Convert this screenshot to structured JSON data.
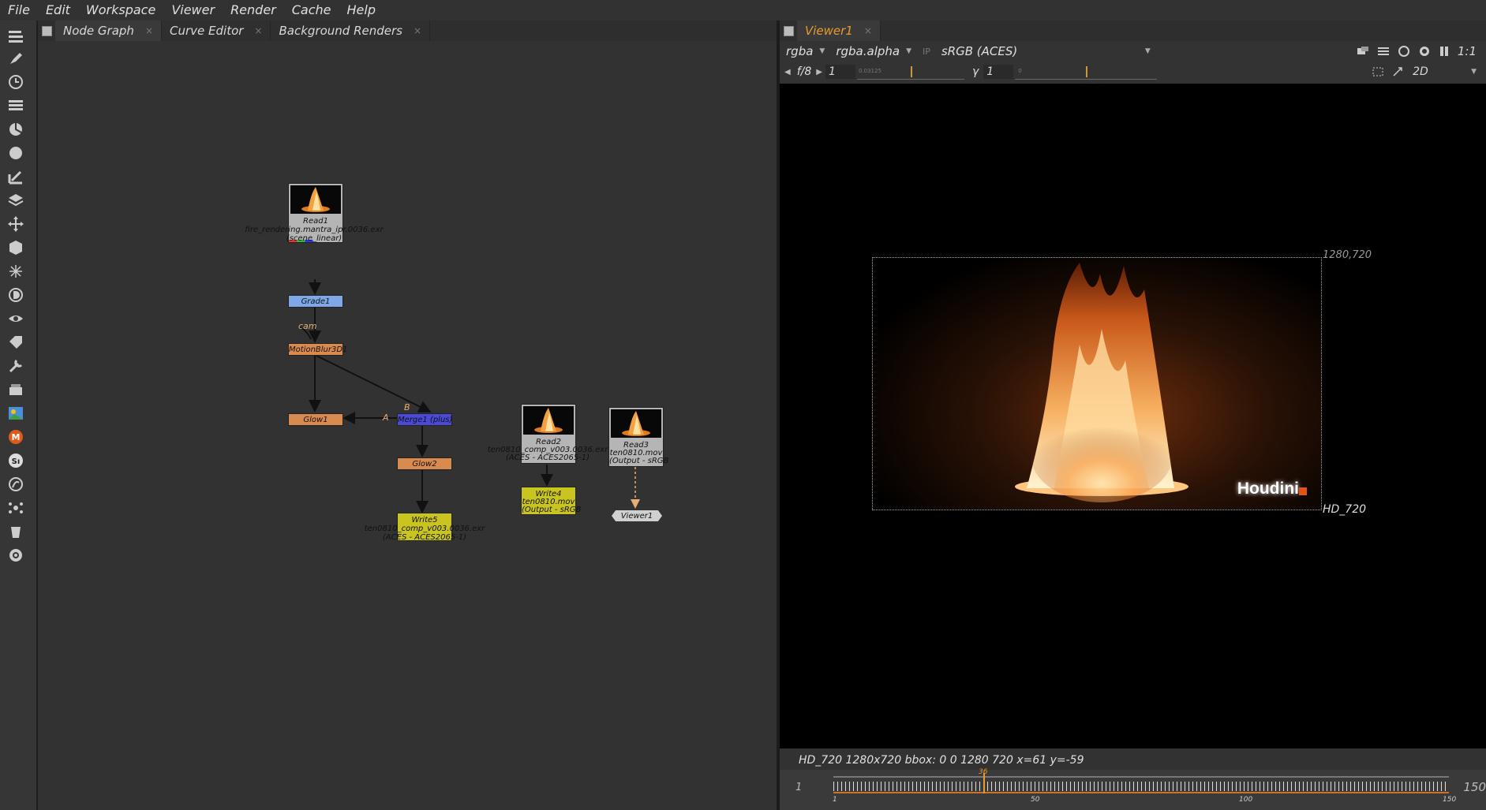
{
  "menu": [
    "File",
    "Edit",
    "Workspace",
    "Viewer",
    "Render",
    "Cache",
    "Help"
  ],
  "left_tabs": [
    {
      "label": "Node Graph",
      "close": "×"
    },
    {
      "label": "Curve Editor",
      "close": "×"
    },
    {
      "label": "Background Renders",
      "close": "×"
    }
  ],
  "toolbar_icons": [
    "image-icon",
    "paint-icon",
    "clock-icon",
    "channel-icon",
    "color-icon",
    "filter-icon",
    "keyer-icon",
    "merge-icon",
    "transform-icon",
    "3d-icon",
    "particle-icon",
    "deep-icon",
    "views-icon",
    "metadata-icon",
    "toolsets-icon",
    "other-icon",
    "furnace-icon",
    "m-icon",
    "s-icon",
    "ocio-icon",
    "spark-icon",
    "bucket-icon",
    "settings-icon"
  ],
  "nodes": {
    "read1": {
      "name": "Read1",
      "file": "fire_rendering.mantra_ipr.0036.exr",
      "colorspace": "(scene_linear)"
    },
    "grade1": {
      "name": "Grade1"
    },
    "motionblur": {
      "name": "MotionBlur3D1"
    },
    "glow1": {
      "name": "Glow1"
    },
    "merge1": {
      "name": "Merge1 (plus)"
    },
    "glow2": {
      "name": "Glow2"
    },
    "write5": {
      "name": "Write5",
      "file": "ten0810_comp_v003.0036.exr",
      "colorspace": "(ACES - ACES2065-1)"
    },
    "read2": {
      "name": "Read2",
      "file": "ten0810_comp_v003.0036.exr",
      "colorspace": "(ACES - ACES2065-1)"
    },
    "write4": {
      "name": "Write4",
      "file": "ten0810.mov",
      "colorspace": "(Output - sRGB"
    },
    "read3": {
      "name": "Read3",
      "file": "ten0810.mov",
      "colorspace": "(Output - sRGB"
    },
    "viewer1": {
      "name": "Viewer1"
    }
  },
  "edge_labels": {
    "cam": "cam",
    "a": "A",
    "b": "B"
  },
  "viewer": {
    "tab": "Viewer1",
    "tab_close": "×",
    "channels": "rgba",
    "alpha": "rgba.alpha",
    "ip": "IP",
    "colorspace": "sRGB (ACES)",
    "zoom": "1:1",
    "fstop": "f/8",
    "gain": "1",
    "gamma_label": "γ",
    "gamma": "1",
    "gain_ticks": "0.03125",
    "gamma_ticks": "0",
    "view_mode": "2D",
    "format_corner": "1280,720",
    "format_name": "HD_720",
    "watermark": "Houdini",
    "status": "HD_720 1280x720  bbox: 0 0 1280 720  x=61 y=-59",
    "frame_current": "1",
    "frame_end": "150",
    "playhead": "36",
    "tick_labels": [
      "1",
      "50",
      "100",
      "150"
    ]
  },
  "colors": {
    "node_read": "#b5b5b5",
    "node_grade": "#7fa8e8",
    "node_filter": "#d98a4e",
    "node_merge": "#4a4ad6",
    "node_write": "#c9c420",
    "accent": "#e89a2e"
  }
}
